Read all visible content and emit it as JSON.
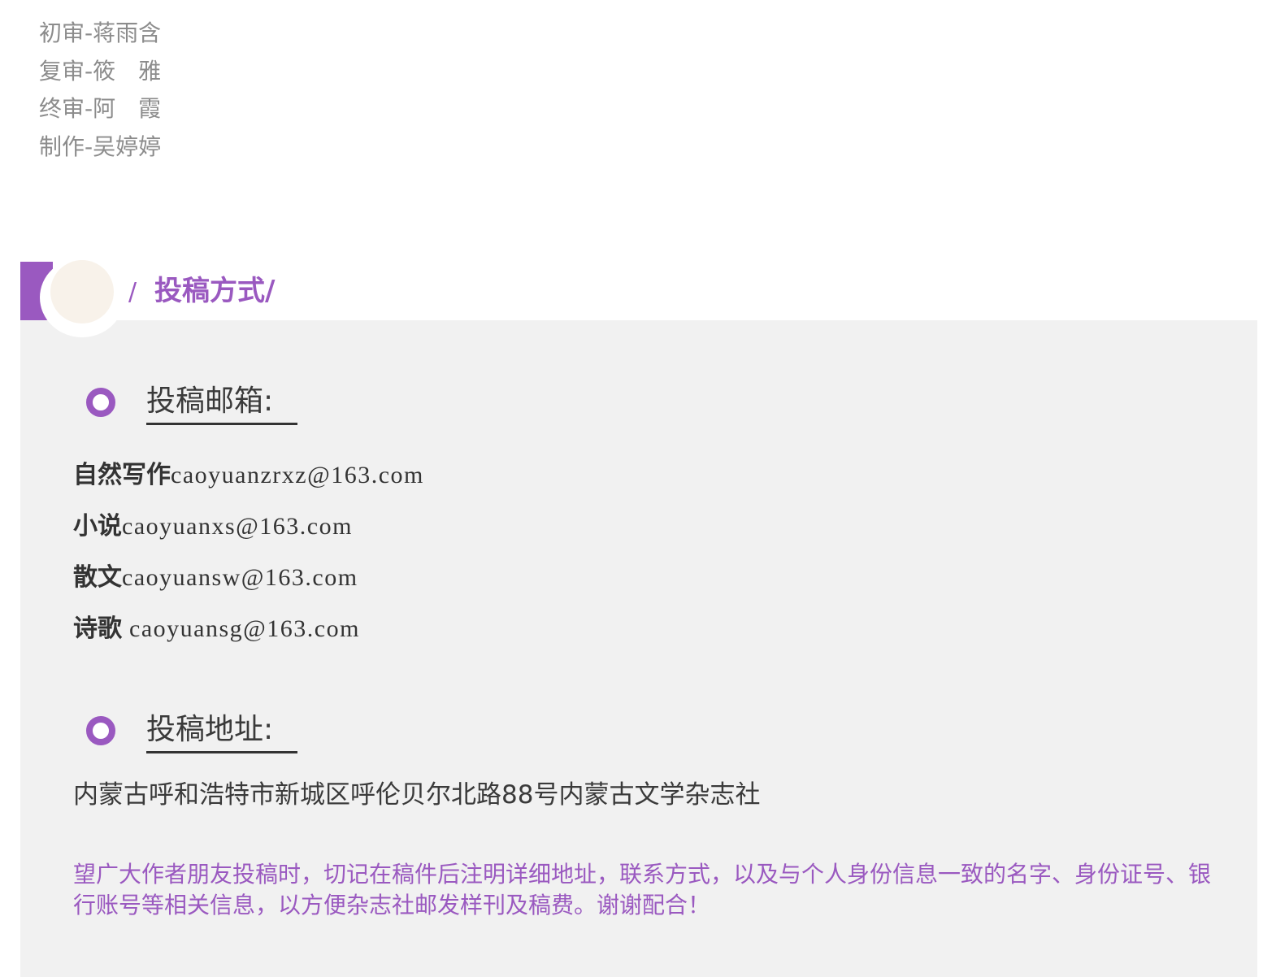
{
  "credits": [
    "初审-蒋雨含",
    "复审-筱　雅",
    "终审-阿　霞",
    "制作-吴婷婷"
  ],
  "header": {
    "slash_left": "/",
    "title": "投稿方式/"
  },
  "email_section": {
    "title": "投稿邮箱:",
    "items": [
      {
        "category": "自然写作",
        "address": "caoyuanzrxz@163.com"
      },
      {
        "category": "小说",
        "address": "caoyuanxs@163.com"
      },
      {
        "category": "散文",
        "address": "caoyuansw@163.com"
      },
      {
        "category": "诗歌",
        "address": " caoyuansg@163.com"
      }
    ]
  },
  "address_section": {
    "title": "投稿地址:",
    "address": "内蒙古呼和浩特市新城区呼伦贝尔北路88号内蒙古文学杂志社"
  },
  "note": "望广大作者朋友投稿时，切记在稿件后注明详细地址，联系方式，以及与个人身份信息一致的名字、身份证号、银行账号等相关信息，以方便杂志社邮发样刊及稿费。谢谢配合！",
  "colors": {
    "accent": "#9a59c0",
    "panel_bg": "#f1f1f1",
    "credit_text": "#8c8c8c"
  }
}
